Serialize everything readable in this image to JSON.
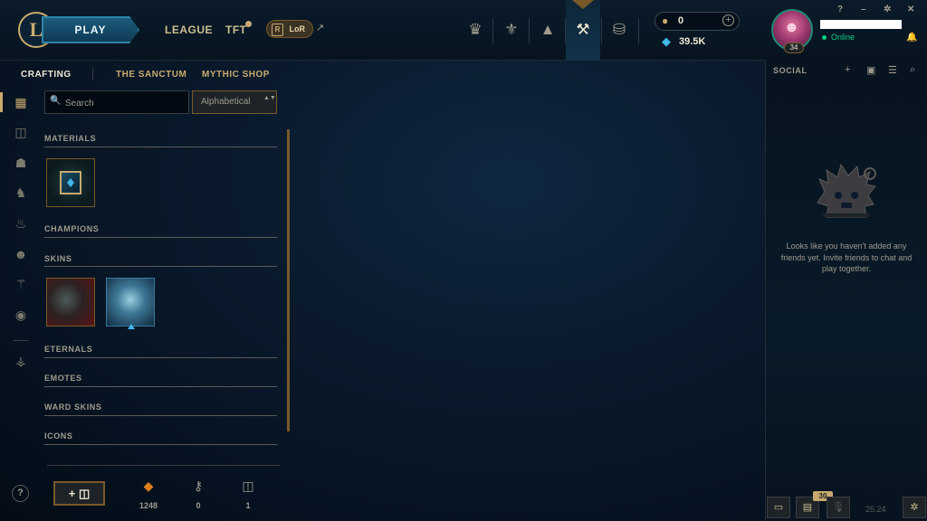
{
  "header": {
    "logo_letter": "L",
    "play_label": "PLAY",
    "nav": [
      {
        "label": "LEAGUE"
      },
      {
        "label": "TFT"
      }
    ],
    "lor_label": "LoR",
    "lor_badge": "R",
    "ext_glyph": "↗",
    "icons": [
      {
        "name": "worlds-trophy-icon",
        "glyph": "♛"
      },
      {
        "name": "ranked-crest-icon",
        "glyph": "⚜"
      },
      {
        "name": "collection-bag-icon",
        "glyph": "▲"
      },
      {
        "name": "loot-hextech-icon",
        "glyph": "⚒"
      },
      {
        "name": "store-coins-icon",
        "glyph": "⛁"
      }
    ],
    "currency": {
      "rp_glyph": "●",
      "rp_value": "0",
      "plus_glyph": "+",
      "be_glyph": "◆",
      "be_value": "39.5K"
    },
    "profile": {
      "level": "34",
      "status": "Online",
      "avatar_glyph": "☻"
    },
    "window": {
      "help": "?",
      "minimize": "–",
      "settings": "✲",
      "close": "✕",
      "bell": "🔔"
    }
  },
  "subnav": {
    "items": [
      {
        "label": "CRAFTING",
        "active": true
      },
      {
        "label": "THE SANCTUM"
      },
      {
        "label": "MYTHIC SHOP"
      }
    ]
  },
  "rail": {
    "icons": [
      {
        "name": "all-grid-icon",
        "glyph": "▦"
      },
      {
        "name": "chest-icon",
        "glyph": "◫"
      },
      {
        "name": "champion-helmet-icon",
        "glyph": "☗"
      },
      {
        "name": "skin-mask-icon",
        "glyph": "♞"
      },
      {
        "name": "eternals-flame-icon",
        "glyph": "♨"
      },
      {
        "name": "emote-face-icon",
        "glyph": "☻"
      },
      {
        "name": "ward-icon",
        "glyph": "⚚"
      },
      {
        "name": "profile-icon-icon",
        "glyph": "◉"
      },
      {
        "name": "tft-companion-icon",
        "glyph": "⚶"
      }
    ],
    "help_label": "?"
  },
  "search": {
    "icon_glyph": "🔍",
    "placeholder": "Search",
    "sort_value": "Alphabetical",
    "sort_caret": "▲▼"
  },
  "loot": {
    "categories": [
      {
        "label": "MATERIALS"
      },
      {
        "label": "CHAMPIONS"
      },
      {
        "label": "SKINS"
      },
      {
        "label": "ETERNALS"
      },
      {
        "label": "EMOTES"
      },
      {
        "label": "WARD SKINS"
      },
      {
        "label": "ICONS"
      }
    ]
  },
  "bottom": {
    "add_label": "+ ◫",
    "counts": [
      {
        "icon": "◆",
        "value": "1248",
        "color": "#e07f1a"
      },
      {
        "icon": "⚷",
        "value": "0",
        "color": "#a09b8c"
      },
      {
        "icon": "◫",
        "value": "1",
        "color": "#a09b8c"
      }
    ]
  },
  "social": {
    "title": "SOCIAL",
    "icons": [
      {
        "name": "add-friend-icon",
        "glyph": "+"
      },
      {
        "name": "add-folder-icon",
        "glyph": "▣"
      },
      {
        "name": "list-view-icon",
        "glyph": "☰"
      },
      {
        "name": "search-friends-icon",
        "glyph": "⌕"
      }
    ],
    "empty_message": "Looks like you haven't added any friends yet. Invite friends to chat and play together.",
    "footer": {
      "chat_glyph": "▭",
      "party_glyph": "▤",
      "party_badge": "30",
      "mic_glyph": "🎙",
      "version": "25.24",
      "bug_glyph": "✲"
    }
  },
  "colors": {
    "gold": "#c8aa6e",
    "blue_essence": "#3fb6e6",
    "online_green": "#0acf83",
    "orange_essence": "#e07f1a"
  }
}
